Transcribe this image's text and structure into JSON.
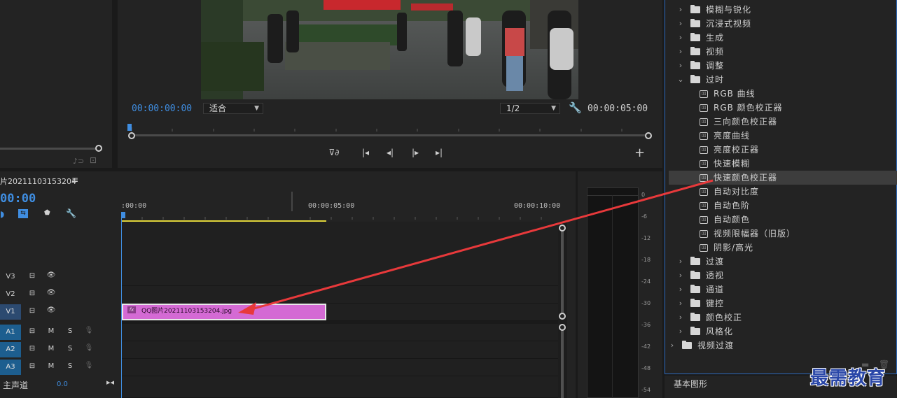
{
  "program_monitor": {
    "current_time": "00:00:00:00",
    "fit_select": "适合",
    "resolution_select": "1/2",
    "duration": "00:00:05:00"
  },
  "sequence": {
    "name": "片20211103153204",
    "menu_icon": "hamburger-icon",
    "timecode": "00:00",
    "ruler": {
      "t0": ":00:00",
      "t5": "00:00:05:00",
      "t10": "00:00:10:00"
    }
  },
  "tracks": {
    "video": [
      "V3",
      "V2",
      "V1"
    ],
    "audio": [
      "A1",
      "A2",
      "A3"
    ],
    "mute_label": "M",
    "solo_label": "S",
    "master_label": "主声道",
    "master_value": "0.0"
  },
  "clip": {
    "fx_badge": "fx",
    "name": "QQ图片20211103153204.jpg",
    "color": "#d46ad4"
  },
  "meter": {
    "scale": [
      "0",
      "-6",
      "-12",
      "-18",
      "-24",
      "-30",
      "-36",
      "-42",
      "-48",
      "-54"
    ]
  },
  "effects": {
    "items": [
      {
        "label": "模糊与锐化",
        "kind": "folder",
        "expanded": false
      },
      {
        "label": "沉浸式视频",
        "kind": "folder",
        "expanded": false
      },
      {
        "label": "生成",
        "kind": "folder",
        "expanded": false
      },
      {
        "label": "视频",
        "kind": "folder",
        "expanded": false
      },
      {
        "label": "调整",
        "kind": "folder",
        "expanded": false
      },
      {
        "label": "过时",
        "kind": "folder",
        "expanded": true
      },
      {
        "label": "RGB 曲线",
        "kind": "effect"
      },
      {
        "label": "RGB 颜色校正器",
        "kind": "effect"
      },
      {
        "label": "三向颜色校正器",
        "kind": "effect"
      },
      {
        "label": "亮度曲线",
        "kind": "effect"
      },
      {
        "label": "亮度校正器",
        "kind": "effect"
      },
      {
        "label": "快速模糊",
        "kind": "effect"
      },
      {
        "label": "快速颜色校正器",
        "kind": "effect",
        "highlighted": true
      },
      {
        "label": "自动对比度",
        "kind": "effect"
      },
      {
        "label": "自动色阶",
        "kind": "effect"
      },
      {
        "label": "自动颜色",
        "kind": "effect"
      },
      {
        "label": "视频限幅器（旧版）",
        "kind": "effect"
      },
      {
        "label": "阴影/高光",
        "kind": "effect"
      },
      {
        "label": "过渡",
        "kind": "folder",
        "expanded": false
      },
      {
        "label": "透视",
        "kind": "folder",
        "expanded": false
      },
      {
        "label": "通道",
        "kind": "folder",
        "expanded": false
      },
      {
        "label": "键控",
        "kind": "folder",
        "expanded": false
      },
      {
        "label": "颜色校正",
        "kind": "folder",
        "expanded": false
      },
      {
        "label": "风格化",
        "kind": "folder",
        "expanded": false
      },
      {
        "label": "视频过渡",
        "kind": "folder",
        "expanded": false,
        "top_level": true
      }
    ]
  },
  "essential_graphics": {
    "label": "基本图形"
  },
  "watermark": "最需教育",
  "colors": {
    "accent_blue": "#3f8de0",
    "annotation_arrow": "#e8393b",
    "playhead_line": "#3f8de0",
    "work_area": "#e0d43a"
  }
}
